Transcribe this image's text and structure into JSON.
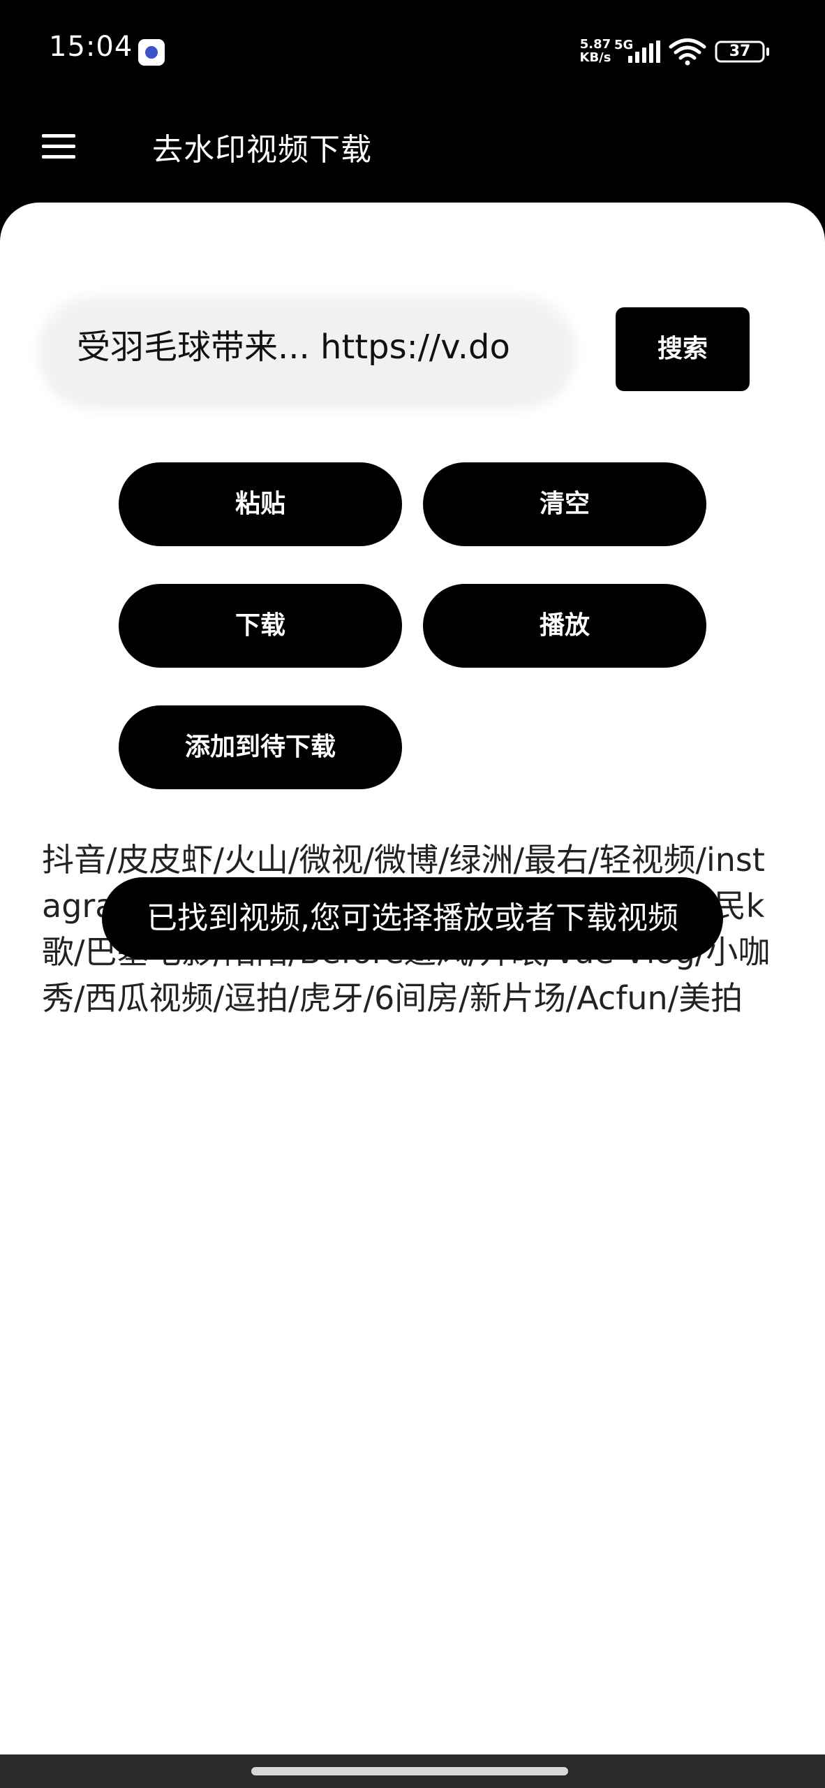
{
  "status_bar": {
    "time": "15:04",
    "net_speed_value": "5.87",
    "net_speed_unit": "KB/s",
    "network_type": "5G",
    "battery_level": "37",
    "icons": [
      "app-notification-icon",
      "signal-icon",
      "wifi-icon",
      "battery-icon"
    ]
  },
  "app_bar": {
    "menu_icon": "menu-icon",
    "title": "去水印视频下载"
  },
  "search": {
    "input_value": "受羽毛球带来... https://v.do",
    "button_label": "搜索"
  },
  "actions": {
    "paste_label": "粘贴",
    "clear_label": "清空",
    "download_label": "下载",
    "play_label": "播放",
    "add_to_queue_label": "添加到待下载"
  },
  "platforms_text": "抖音/皮皮虾/火山/微视/微博/绿洲/最右/轻视频/instagram/哔哩哔哩/快手/全民小视频/皮皮搞笑/全民k歌/巴塞电影/陌陌/Before避风/开眼/Vue Vlog/小咖秀/西瓜视频/逗拍/虎牙/6间房/新片场/Acfun/美拍",
  "toast": {
    "message": "已找到视频,您可选择播放或者下载视频"
  },
  "colors": {
    "background": "#000000",
    "card": "#ffffff",
    "button": "#000000",
    "input": "#f1f1f1"
  }
}
